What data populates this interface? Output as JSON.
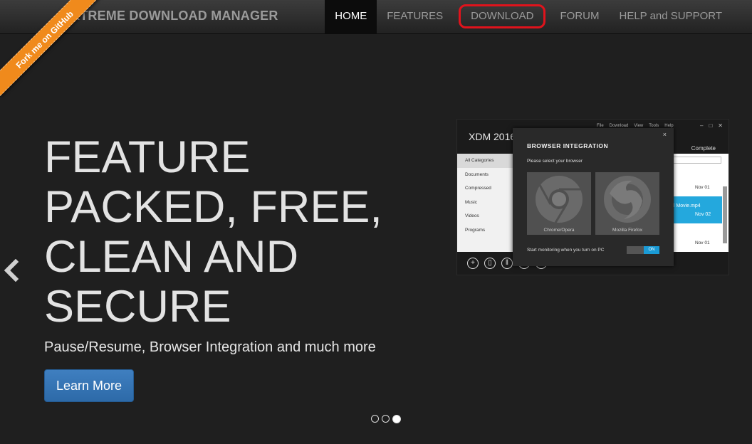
{
  "navbar": {
    "brand": "XTREME DOWNLOAD MANAGER",
    "items": [
      {
        "label": "HOME"
      },
      {
        "label": "FEATURES"
      },
      {
        "label": "DOWNLOAD"
      },
      {
        "label": "FORUM"
      },
      {
        "label": "HELP and SUPPORT"
      }
    ]
  },
  "ribbon": {
    "label": "Fork me on GitHub"
  },
  "hero": {
    "title": "FEATURE PACKED, FREE, CLEAN AND SECURE",
    "subtitle": "Pause/Resume, Browser Integration and much more",
    "cta": "Learn More"
  },
  "carousel": {
    "slide_count": 3,
    "active_index": 2
  },
  "app": {
    "title": "XDM 2016",
    "menu": [
      "File",
      "Download",
      "View",
      "Tools",
      "Help"
    ],
    "complete_tab": "Complete",
    "categories": [
      "All Categories",
      "Documents",
      "Compressed",
      "Music",
      "Videos",
      "Programs"
    ],
    "rows": [
      {
        "date": "Nov 01"
      },
      {
        "name": "ul Movie.mp4",
        "date": "Nov 02"
      },
      {
        "date": "Nov 01"
      }
    ],
    "dialog": {
      "close": "×",
      "title": "BROWSER INTEGRATION",
      "subtitle": "Please select your browser",
      "browsers": [
        {
          "label": "Chrome/Opera"
        },
        {
          "label": "Mozilla Firefox"
        }
      ],
      "monitor_text": "Start monitoring when you turn on PC",
      "toggle": "ON"
    }
  },
  "colors": {
    "highlight": "#e0131c",
    "button": "#3f7fc0",
    "ribbon": "#f08a1c",
    "accent": "#24a8dd"
  }
}
